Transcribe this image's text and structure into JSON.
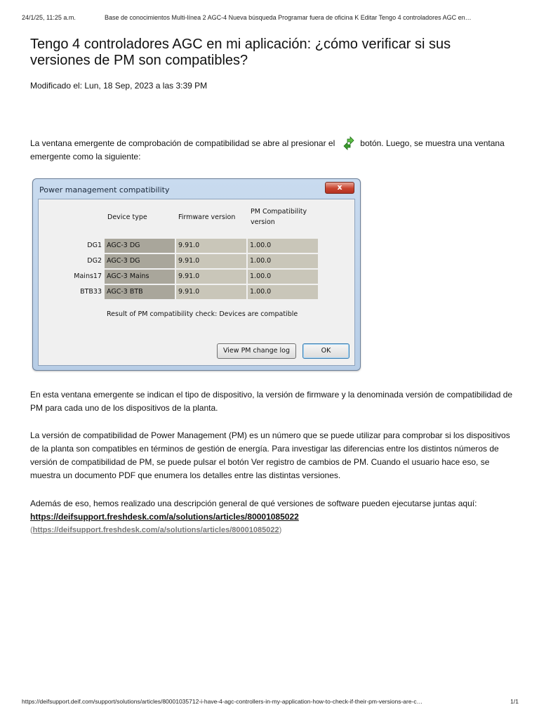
{
  "print_header": {
    "timestamp": "24/1/25, 11:25 a.m.",
    "title": "Base de conocimientos Multi-línea 2 AGC-4 Nueva búsqueda Programar fuera de oficina K Editar Tengo 4 controladores AGC en…"
  },
  "article": {
    "title": "Tengo 4 controladores AGC en mi aplicación: ¿cómo verificar si sus versiones de PM son compatibles?",
    "modified": "Modificado el: Lun, 18 Sep, 2023 a las 3:39 PM",
    "intro_before_icon": "La ventana emergente de comprobación de compatibilidad se abre al presionar el",
    "intro_icon": "pm-compatibility-check-icon",
    "intro_after_icon": "botón. Luego, se muestra una ventana emergente como la siguiente:",
    "paragraph_2": "En esta ventana emergente se indican el tipo de dispositivo, la versión de firmware y la denominada versión de compatibilidad de PM para cada uno de los dispositivos de la planta.",
    "paragraph_3": "La versión de compatibilidad de Power Management (PM) es un número que se puede utilizar para comprobar si los dispositivos de la planta son compatibles en términos de gestión de energía. Para investigar las diferencias entre los distintos números de versión de compatibilidad de PM, se puede pulsar el botón Ver registro de cambios de PM. Cuando el usuario hace eso, se muestra un documento PDF que enumera los detalles entre las distintas versiones.",
    "paragraph_4": "Además de eso, hemos realizado una descripción general de qué versiones de software pueden ejecutarse juntas aquí:",
    "link_text": "https://deifsupport.freshdesk.com/a/solutions/articles/80001085022",
    "link_paren_open": "(",
    "link_paren_text": "https://deifsupport.freshdesk.com/a/solutions/articles/80001085022",
    "link_paren_close": ")"
  },
  "dialog": {
    "title": "Power management compatibility",
    "close_label": "x",
    "headers": {
      "device_type": "Device type",
      "firmware": "Firmware version",
      "pm_line1": "PM Compatibility",
      "pm_line2": "version"
    },
    "rows": [
      {
        "label": "DG1",
        "type": "AGC-3 DG",
        "firmware": "9.91.0",
        "pm": "1.00.0"
      },
      {
        "label": "DG2",
        "type": "AGC-3 DG",
        "firmware": "9.91.0",
        "pm": "1.00.0"
      },
      {
        "label": "Mains17",
        "type": "AGC-3 Mains",
        "firmware": "9.91.0",
        "pm": "1.00.0"
      },
      {
        "label": "BTB33",
        "type": "AGC-3 BTB",
        "firmware": "9.91.0",
        "pm": "1.00.0"
      }
    ],
    "result": "Result of PM compatibility check: Devices are compatible",
    "change_log_button": "View PM change log",
    "ok_button": "OK"
  },
  "print_footer": {
    "url": "https://deifsupport.deif.com/support/solutions/articles/80001035712-i-have-4-agc-controllers-in-my-application-how-to-check-if-their-pm-versions-are-c…",
    "page": "1/1"
  },
  "colors": {
    "dialog_frame": "#b7cde6",
    "cell_type": "#a9a69b",
    "cell_value": "#c9c6b9",
    "close_button": "#c9442f"
  }
}
